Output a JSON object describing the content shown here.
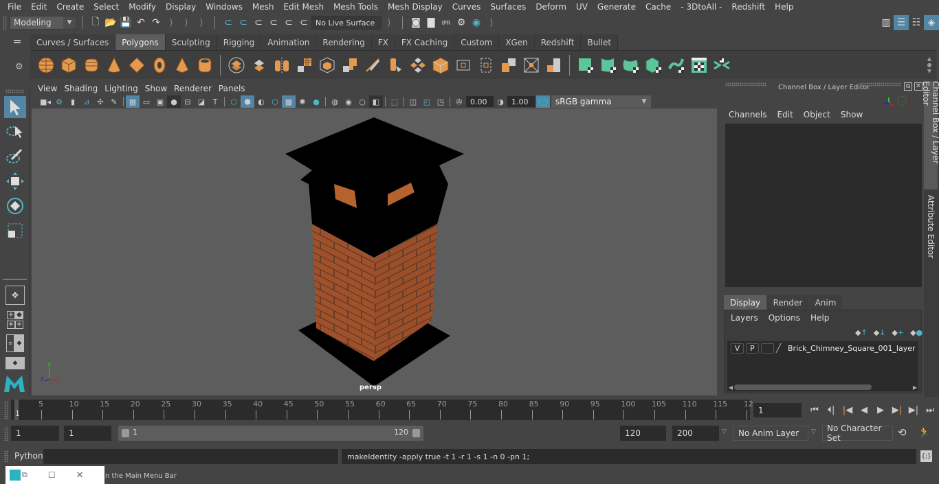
{
  "menubar": {
    "items": [
      "File",
      "Edit",
      "Create",
      "Select",
      "Modify",
      "Display",
      "Windows",
      "Mesh",
      "Edit Mesh",
      "Mesh Tools",
      "Mesh Display",
      "Curves",
      "Surfaces",
      "Deform",
      "UV",
      "Generate",
      "Cache",
      "- 3DtoAll -",
      "Redshift",
      "Help"
    ]
  },
  "statusline": {
    "mode": "Modeling",
    "live_surface": "No Live Surface"
  },
  "shelf": {
    "tabs": [
      "Curves / Surfaces",
      "Polygons",
      "Sculpting",
      "Rigging",
      "Animation",
      "Rendering",
      "FX",
      "FX Caching",
      "Custom",
      "XGen",
      "Redshift",
      "Bullet"
    ],
    "active_tab": "Polygons"
  },
  "viewport": {
    "menu": [
      "View",
      "Shading",
      "Lighting",
      "Show",
      "Renderer",
      "Panels"
    ],
    "exposure": "0.00",
    "gamma": "1.00",
    "color_mgmt_badge": "ON",
    "color_space": "sRGB gamma",
    "camera_label": "persp",
    "axis": {
      "x": "x",
      "y": "y",
      "z": "z"
    }
  },
  "channel_box": {
    "title": "Channel Box / Layer Editor",
    "menu": [
      "Channels",
      "Edit",
      "Object",
      "Show"
    ]
  },
  "layer_editor": {
    "tabs": [
      "Display",
      "Render",
      "Anim"
    ],
    "active_tab": "Display",
    "menu": [
      "Layers",
      "Options",
      "Help"
    ],
    "layers": [
      {
        "v": "V",
        "p": "P",
        "name": "Brick_Chimney_Square_001_layer"
      }
    ]
  },
  "side_tabs": [
    "Channel Box / Layer Editor",
    "Attribute Editor"
  ],
  "timeline": {
    "ticks": [
      "5",
      "10",
      "15",
      "20",
      "25",
      "30",
      "35",
      "40",
      "45",
      "50",
      "55",
      "60",
      "65",
      "70",
      "75",
      "80",
      "85",
      "90",
      "95",
      "100",
      "105",
      "110",
      "115",
      "12"
    ],
    "current_marker": "1",
    "current_frame": "1"
  },
  "range": {
    "start": "1",
    "anim_start": "1",
    "slider_start": "1",
    "slider_end": "120",
    "anim_end": "120",
    "end": "200",
    "anim_layer": "No Anim Layer",
    "char_set": "No Character Set"
  },
  "cmdline": {
    "lang": "Python",
    "input": "",
    "result": "makeIdentity -apply true -t 1 -r 1 -s 1 -n 0 -pn 1;"
  },
  "helpline": {
    "text": "n the Main Menu Bar"
  }
}
